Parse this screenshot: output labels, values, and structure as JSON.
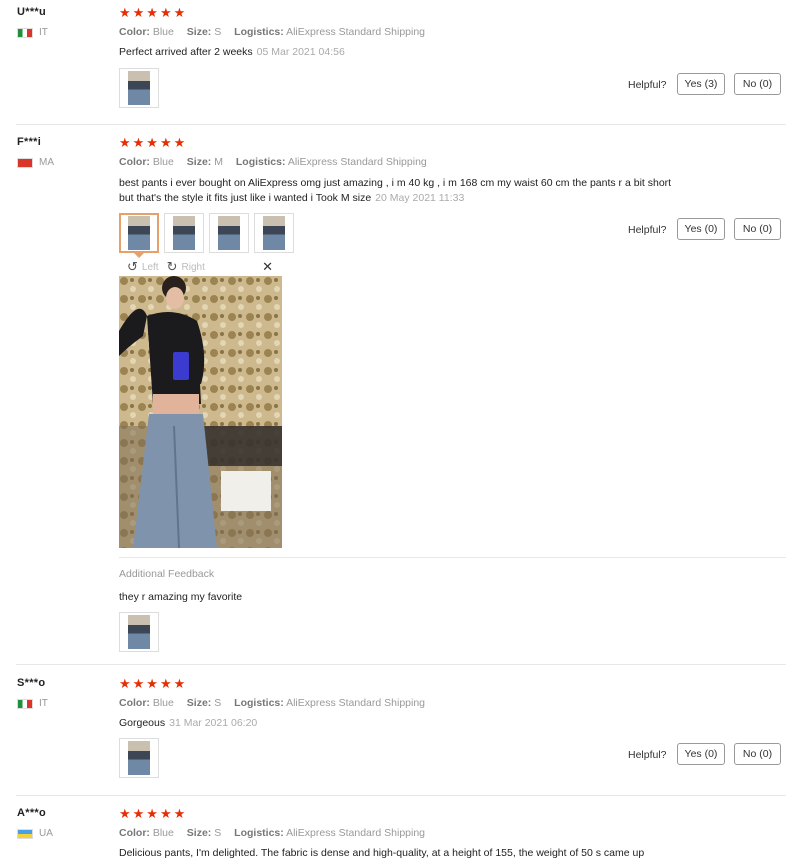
{
  "reviews": [
    {
      "user": "U***u",
      "country": "IT",
      "stars": "★★★★★",
      "color_label": "Color:",
      "color": "Blue",
      "size_label": "Size:",
      "size": "S",
      "logistics_label": "Logistics:",
      "logistics": "AliExpress Standard Shipping",
      "text": "Perfect arrived after 2 weeks",
      "date": "05 Mar 2021 04:56",
      "helpful": "Helpful?",
      "yes": "Yes (3)",
      "no": "No (0)"
    },
    {
      "user": "F***i",
      "country": "MA",
      "stars": "★★★★★",
      "color_label": "Color:",
      "color": "Blue",
      "size_label": "Size:",
      "size": "M",
      "logistics_label": "Logistics:",
      "logistics": "AliExpress Standard Shipping",
      "text_line1": "best pants i ever bought on AliExpress omg just amazing , i m 40 kg , i m 168 cm my waist 60 cm the pants r a bit short",
      "text_line2": "but that's the style it fits just like i wanted i Took M size",
      "date": "20 May 2021 11:33",
      "helpful": "Helpful?",
      "yes": "Yes (0)",
      "no": "No (0)",
      "viewer": {
        "left": "Left",
        "right": "Right",
        "close": "✕"
      },
      "additional_label": "Additional Feedback",
      "additional_text": "they r amazing my favorite"
    },
    {
      "user": "S***o",
      "country": "IT",
      "stars": "★★★★★",
      "color_label": "Color:",
      "color": "Blue",
      "size_label": "Size:",
      "size": "S",
      "logistics_label": "Logistics:",
      "logistics": "AliExpress Standard Shipping",
      "text": "Gorgeous",
      "date": "31 Mar 2021 06:20",
      "helpful": "Helpful?",
      "yes": "Yes (0)",
      "no": "No (0)"
    },
    {
      "user": "A***o",
      "country": "UA",
      "stars": "★★★★★",
      "color_label": "Color:",
      "color": "Blue",
      "size_label": "Size:",
      "size": "S",
      "logistics_label": "Logistics:",
      "logistics": "AliExpress Standard Shipping",
      "text": "Delicious pants, I'm delighted. The fabric is dense and high-quality, at a height of 155, the weight of 50 s came up"
    }
  ],
  "colors": {
    "star": "#e62e04",
    "thumb_active": "#e4a16b"
  },
  "icons": {
    "rotate_left": "rotate-left-icon",
    "rotate_right": "rotate-right-icon",
    "close": "close-icon"
  }
}
